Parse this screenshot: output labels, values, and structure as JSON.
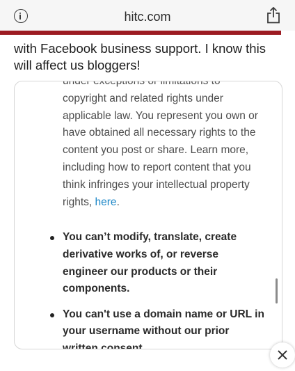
{
  "browser": {
    "url": "hitc.com",
    "info_icon": "info-icon",
    "share_icon": "share-icon"
  },
  "accent_color": "#9c1b22",
  "article": {
    "text": "with Facebook business support. I know this will affect us bloggers!"
  },
  "embed": {
    "partial_line": "under exceptions or limitations to",
    "paragraph_text": "copyright and related rights under applicable law. You represent you own or have obtained all necessary rights to the content you post or share. Learn more, including how to report content that you think infringes your intellectual property rights,",
    "link_label": "here",
    "link_tail": ".",
    "bullets": [
      "You can’t modify, translate, create derivative works of, or reverse engineer our products or their components.",
      "You can't use a domain name or URL in your username without our prior written consent."
    ]
  },
  "close_icon": "close-icon"
}
